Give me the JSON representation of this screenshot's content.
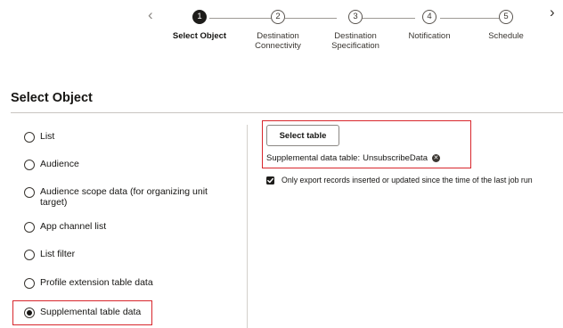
{
  "wizard": {
    "steps": [
      {
        "number": "1",
        "label": "Select Object",
        "active": true
      },
      {
        "number": "2",
        "label_line1": "Destination",
        "label_line2": "Connectivity"
      },
      {
        "number": "3",
        "label_line1": "Destination",
        "label_line2": "Specification"
      },
      {
        "number": "4",
        "label": "Notification"
      },
      {
        "number": "5",
        "label": "Schedule"
      }
    ],
    "prev_icon": "chevron-left-icon",
    "next_icon": "chevron-right-icon"
  },
  "page": {
    "title": "Select Object"
  },
  "object_types": {
    "options": [
      {
        "label": "List"
      },
      {
        "label": "Audience"
      },
      {
        "label_line1": "Audience scope data (for organizing unit",
        "label_line2": "target)"
      },
      {
        "label": "App channel list"
      },
      {
        "label": "List filter"
      },
      {
        "label": "Profile extension table data"
      },
      {
        "label": "Supplemental table data"
      }
    ],
    "selected": "Supplemental table data"
  },
  "supplemental": {
    "select_button_label": "Select table",
    "table_label": "Supplemental data table:",
    "table_value": "UnsubscribeData",
    "remove_icon": "remove-icon"
  },
  "export_option": {
    "label": "Only export records inserted or updated since the time of the last job run",
    "checked": true
  },
  "colors": {
    "highlight": "#d8262c",
    "active_step": "#1d1c1a"
  }
}
